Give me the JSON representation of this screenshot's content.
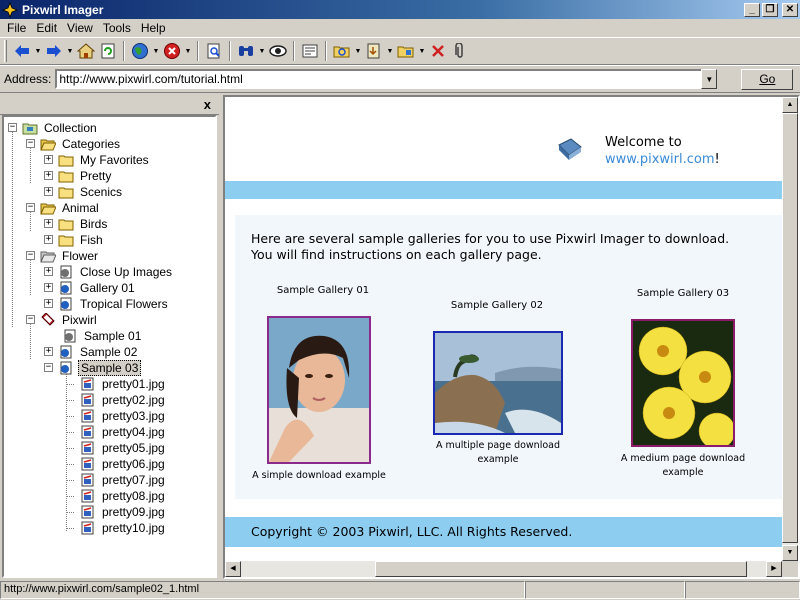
{
  "window": {
    "title": "Pixwirl Imager"
  },
  "menu": [
    "File",
    "Edit",
    "View",
    "Tools",
    "Help"
  ],
  "address": {
    "label": "Address:",
    "url": "http://www.pixwirl.com/tutorial.html",
    "go_label": "Go"
  },
  "pane": {
    "close_label": "x"
  },
  "tree": {
    "root": "Collection",
    "categories": "Categories",
    "my_favorites": "My Favorites",
    "pretty": "Pretty",
    "scenics": "Scenics",
    "animal": "Animal",
    "birds": "Birds",
    "fish": "Fish",
    "flower": "Flower",
    "close_up_images": "Close Up Images",
    "gallery_01": "Gallery 01",
    "tropical_flowers": "Tropical Flowers",
    "pixwirl": "Pixwirl",
    "sample_01": "Sample 01",
    "sample_02": "Sample 02",
    "sample_03": "Sample 03",
    "files": [
      "pretty01.jpg",
      "pretty02.jpg",
      "pretty03.jpg",
      "pretty04.jpg",
      "pretty05.jpg",
      "pretty06.jpg",
      "pretty07.jpg",
      "pretty08.jpg",
      "pretty09.jpg",
      "pretty10.jpg"
    ]
  },
  "page": {
    "welcome_prefix": "Welcome to",
    "welcome_link": "www.pixwirl.com",
    "welcome_suffix": "!",
    "intro_line1": "Here are several sample galleries for you to use Pixwirl Imager to download.",
    "intro_line2": "You will find instructions on each gallery page.",
    "galleries": [
      {
        "title": "Sample Gallery 01",
        "caption_line1": "A simple download example",
        "caption_line2": ""
      },
      {
        "title": "Sample Gallery 02",
        "caption_line1": "A multiple page download",
        "caption_line2": "example"
      },
      {
        "title": "Sample Gallery 03",
        "caption_line1": "A medium page download",
        "caption_line2": "example"
      }
    ],
    "copyright": "Copyright © 2003 Pixwirl, LLC. All Rights Reserved."
  },
  "status": {
    "text": "http://www.pixwirl.com/sample02_1.html"
  },
  "colors": {
    "band": "#8ccdf0",
    "link": "#3a8ad6",
    "title_bar": "#0a246a"
  }
}
